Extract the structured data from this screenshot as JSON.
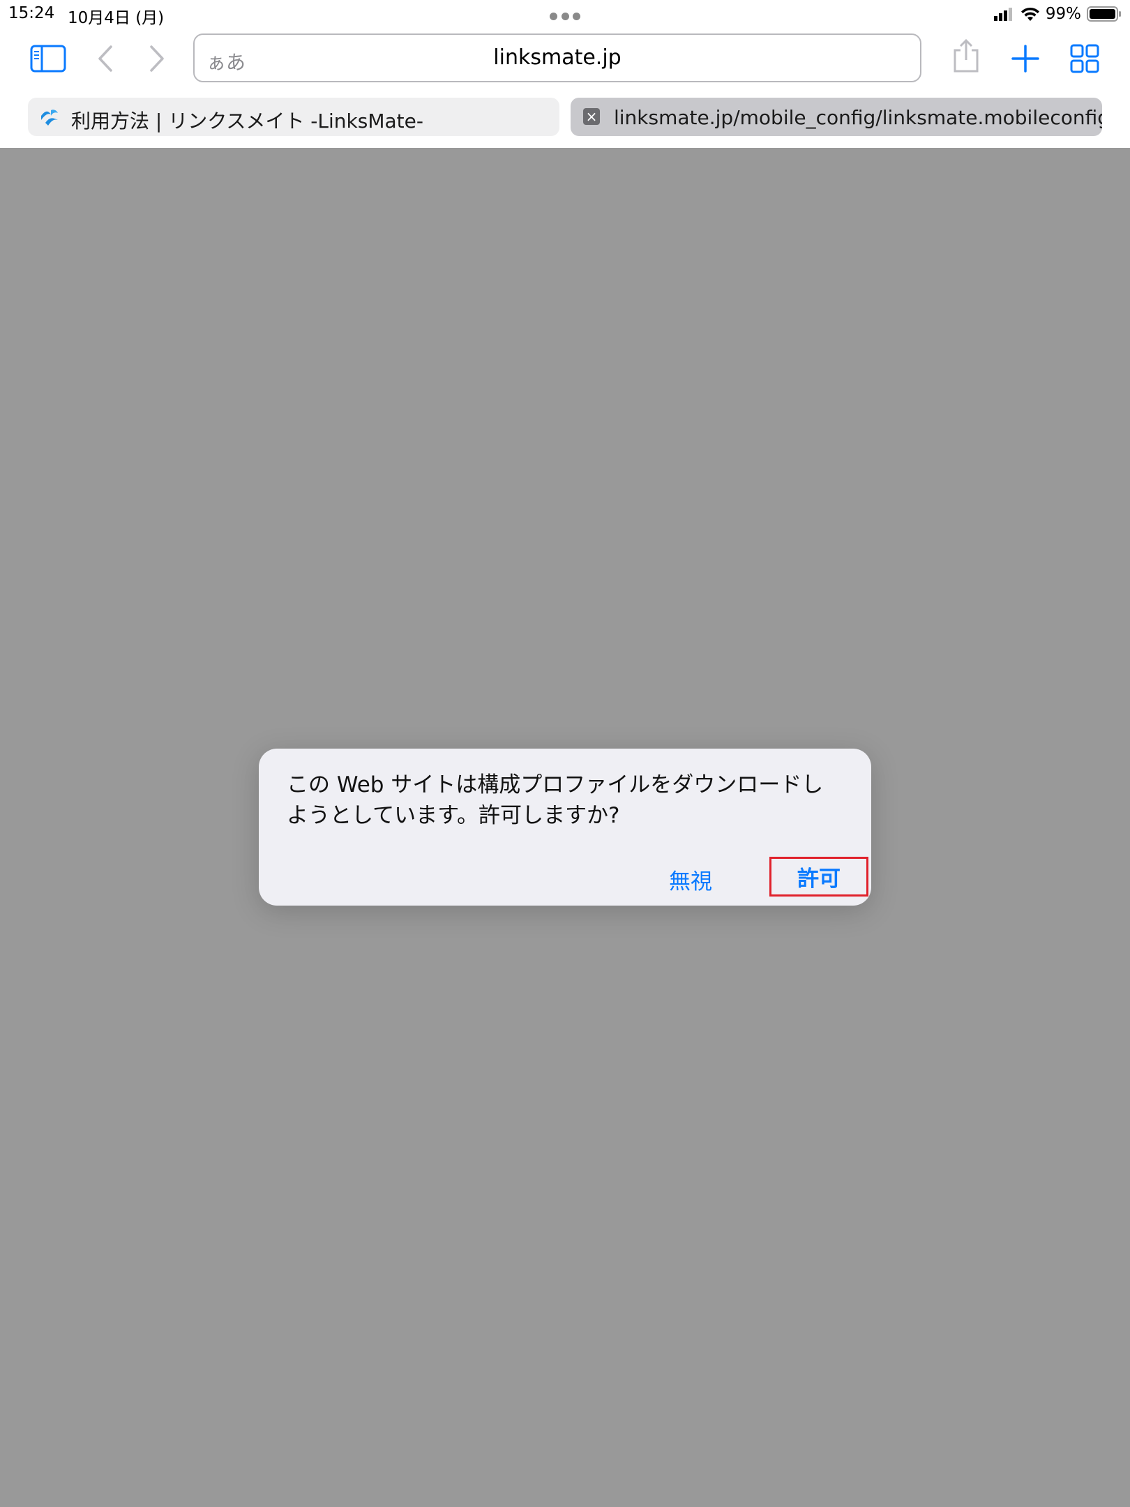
{
  "status_bar": {
    "time": "15:24",
    "date": "10月4日 (月)",
    "battery_percent": "99%",
    "battery_level": 0.99,
    "signal_icon": "cellular-signal-icon",
    "wifi_icon": "wifi-icon"
  },
  "toolbar": {
    "sidebar_icon": "sidebar-icon",
    "back_icon": "chevron-left-icon",
    "forward_icon": "chevron-right-icon",
    "reader_label": "ぁあ",
    "url": "linksmate.jp",
    "share_icon": "share-icon",
    "new_tab_icon": "plus-icon",
    "tabs_overview_icon": "grid-icon"
  },
  "tabs": [
    {
      "title": "利用方法 | リンクスメイト -LinksMate-",
      "icon": "linksmate-favicon",
      "active": false
    },
    {
      "title": "linksmate.jp/mobile_config/linksmate.mobileconfig",
      "icon": "close-icon",
      "active": true
    }
  ],
  "dialog": {
    "message": "この Web サイトは構成プロファイルをダウンロードしようとしています。許可しますか?",
    "ignore_label": "無視",
    "allow_label": "許可"
  },
  "colors": {
    "accent": "#0a7aff",
    "highlight_border": "#e0212b",
    "page_background": "#999999"
  }
}
